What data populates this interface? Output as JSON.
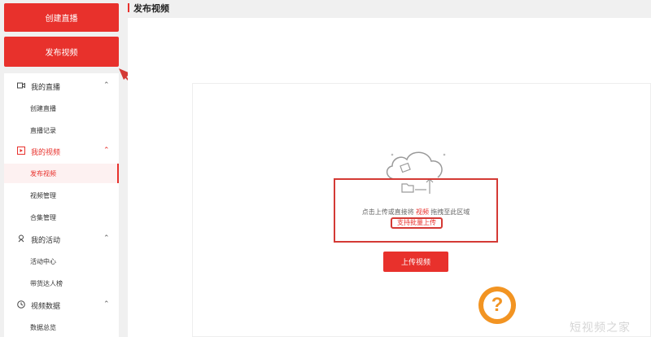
{
  "sidebar": {
    "create_live_button": "创建直播",
    "publish_video_button": "发布视频",
    "groups": [
      {
        "label": "我的直播",
        "icon": "video-camera-icon",
        "items": [
          "创建直播",
          "直播记录"
        ]
      },
      {
        "label": "我的视频",
        "icon": "play-square-icon",
        "items": [
          "发布视频",
          "视频管理",
          "合集管理"
        ]
      },
      {
        "label": "我的活动",
        "icon": "activity-icon",
        "items": [
          "活动中心",
          "带货达人榜"
        ]
      },
      {
        "label": "视频数据",
        "icon": "clock-icon",
        "items": [
          "数据总览"
        ]
      }
    ],
    "active_item": "发布视频"
  },
  "header": {
    "title": "发布视频"
  },
  "upload": {
    "hint_prefix": "点击上传或直接将",
    "hint_link": "视频",
    "hint_suffix": "拖拽至此区域",
    "batch_label": "支持批量上传",
    "upload_button": "上传视频"
  },
  "watermark": {
    "text": "短视频之家"
  },
  "colors": {
    "accent": "#e8312c",
    "watermark_orange": "#f29422"
  }
}
